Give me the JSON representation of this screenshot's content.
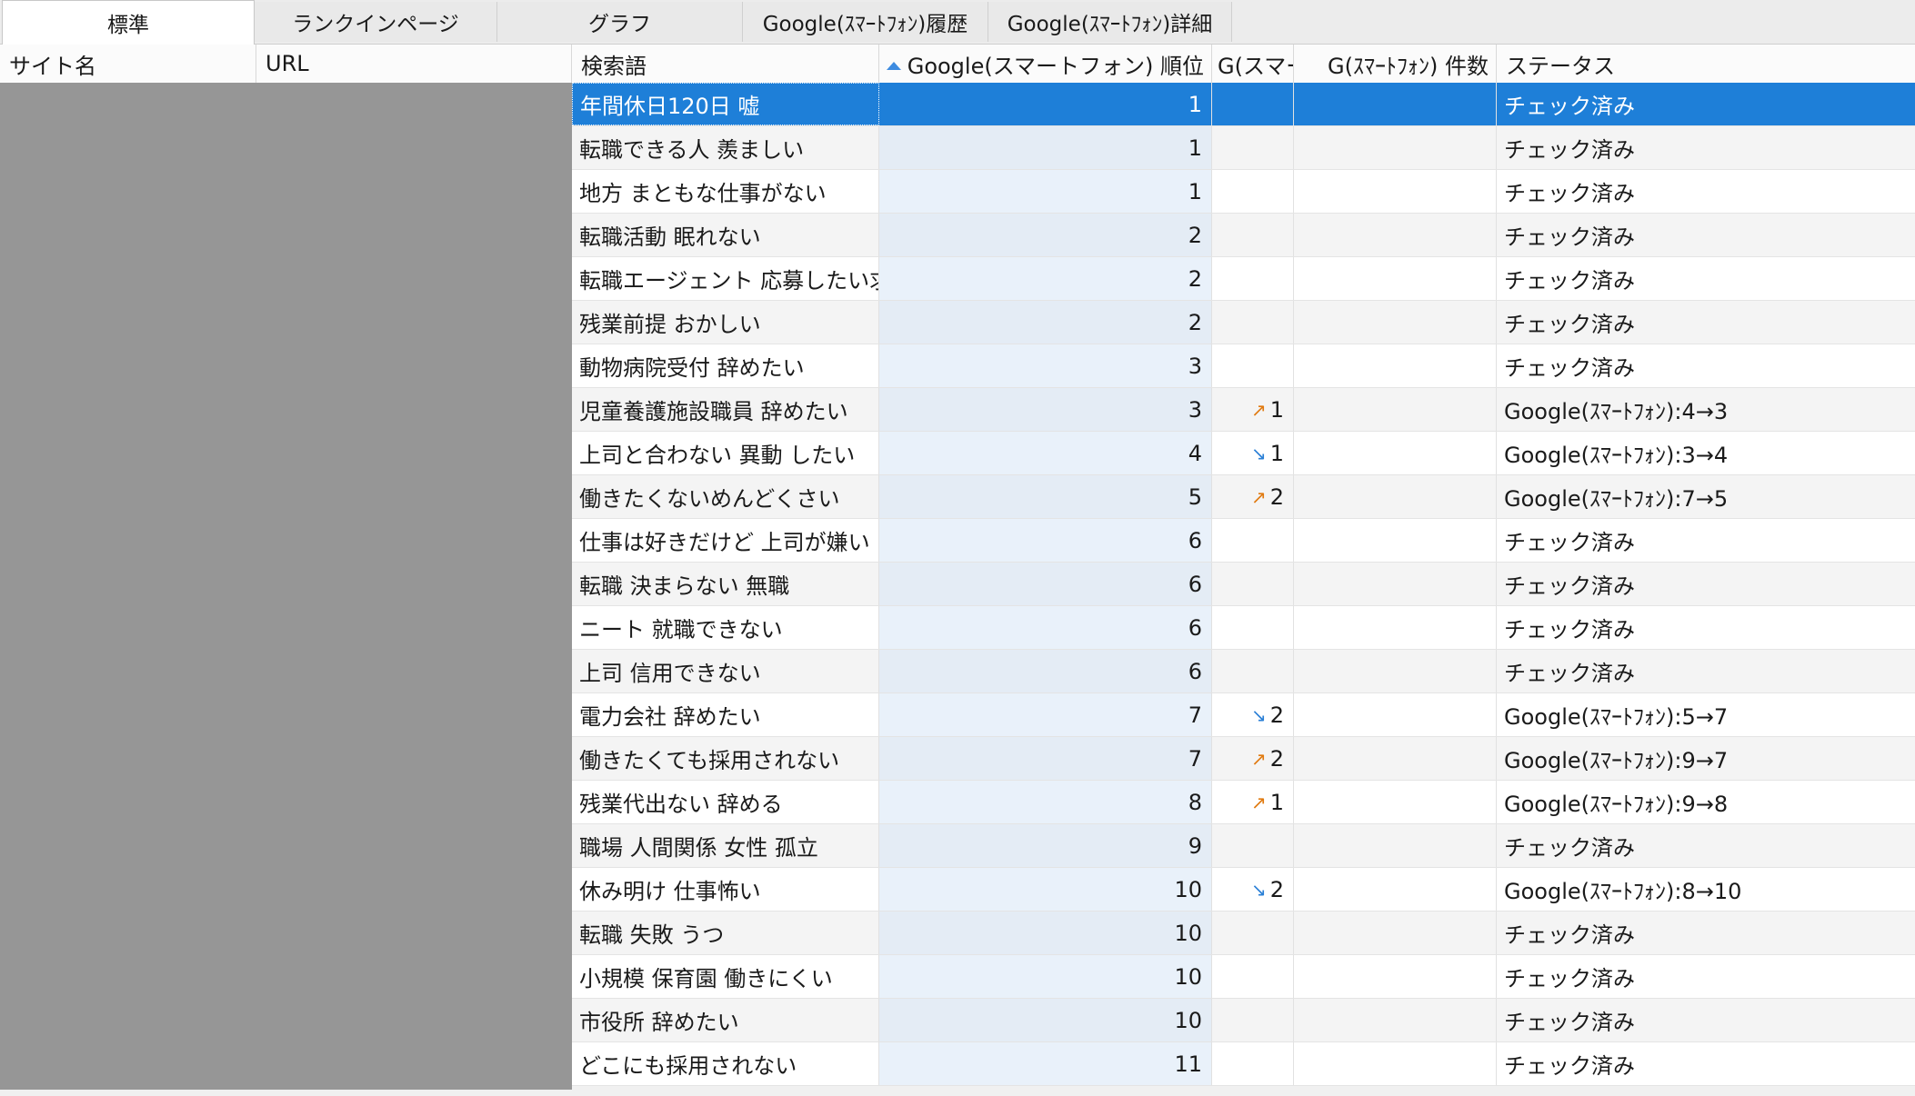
{
  "tabs": [
    {
      "label": "標準",
      "active": true
    },
    {
      "label": "ランクインページ",
      "active": false
    },
    {
      "label": "グラフ",
      "active": false
    },
    {
      "label": "Google(ｽﾏｰﾄﾌｫﾝ)履歴",
      "active": false
    },
    {
      "label": "Google(ｽﾏｰﾄﾌｫﾝ)詳細",
      "active": false
    }
  ],
  "columns": {
    "site": "サイト名",
    "url": "URL",
    "keyword": "検索語",
    "rank": "Google(スマートフォン) 順位",
    "change": "G(スマー..",
    "count": "G(ｽﾏｰﾄﾌｫﾝ) 件数",
    "status": "ステータス"
  },
  "colors": {
    "selected": "#1e7fd8",
    "up_arrow": "#e07a10",
    "down_arrow": "#2a7fd6",
    "redacted_block": "#969696"
  },
  "rows": [
    {
      "keyword": "年間休日120日 嘘",
      "rank": "1",
      "change_dir": "",
      "change": "",
      "status": "チェック済み",
      "selected": true
    },
    {
      "keyword": "転職できる人 羨ましい",
      "rank": "1",
      "change_dir": "",
      "change": "",
      "status": "チェック済み"
    },
    {
      "keyword": "地方 まともな仕事がない",
      "rank": "1",
      "change_dir": "",
      "change": "",
      "status": "チェック済み"
    },
    {
      "keyword": "転職活動 眠れない",
      "rank": "2",
      "change_dir": "",
      "change": "",
      "status": "チェック済み"
    },
    {
      "keyword": "転職エージェント 応募したい求人..",
      "rank": "2",
      "change_dir": "",
      "change": "",
      "status": "チェック済み"
    },
    {
      "keyword": "残業前提 おかしい",
      "rank": "2",
      "change_dir": "",
      "change": "",
      "status": "チェック済み"
    },
    {
      "keyword": "動物病院受付 辞めたい",
      "rank": "3",
      "change_dir": "",
      "change": "",
      "status": "チェック済み"
    },
    {
      "keyword": "児童養護施設職員 辞めたい",
      "rank": "3",
      "change_dir": "up",
      "change": "1",
      "status": "Google(ｽﾏｰﾄﾌｫﾝ):4→3"
    },
    {
      "keyword": "上司と合わない 異動 したい",
      "rank": "4",
      "change_dir": "down",
      "change": "1",
      "status": "Google(ｽﾏｰﾄﾌｫﾝ):3→4"
    },
    {
      "keyword": "働きたくないめんどくさい",
      "rank": "5",
      "change_dir": "up",
      "change": "2",
      "status": "Google(ｽﾏｰﾄﾌｫﾝ):7→5"
    },
    {
      "keyword": "仕事は好きだけど 上司が嫌い",
      "rank": "6",
      "change_dir": "",
      "change": "",
      "status": "チェック済み"
    },
    {
      "keyword": "転職 決まらない 無職",
      "rank": "6",
      "change_dir": "",
      "change": "",
      "status": "チェック済み"
    },
    {
      "keyword": "ニート 就職できない",
      "rank": "6",
      "change_dir": "",
      "change": "",
      "status": "チェック済み"
    },
    {
      "keyword": "上司 信用できない",
      "rank": "6",
      "change_dir": "",
      "change": "",
      "status": "チェック済み"
    },
    {
      "keyword": "電力会社 辞めたい",
      "rank": "7",
      "change_dir": "down",
      "change": "2",
      "status": "Google(ｽﾏｰﾄﾌｫﾝ):5→7"
    },
    {
      "keyword": "働きたくても採用されない",
      "rank": "7",
      "change_dir": "up",
      "change": "2",
      "status": "Google(ｽﾏｰﾄﾌｫﾝ):9→7"
    },
    {
      "keyword": "残業代出ない 辞める",
      "rank": "8",
      "change_dir": "up",
      "change": "1",
      "status": "Google(ｽﾏｰﾄﾌｫﾝ):9→8"
    },
    {
      "keyword": "職場 人間関係 女性 孤立",
      "rank": "9",
      "change_dir": "",
      "change": "",
      "status": "チェック済み"
    },
    {
      "keyword": "休み明け 仕事怖い",
      "rank": "10",
      "change_dir": "down",
      "change": "2",
      "status": "Google(ｽﾏｰﾄﾌｫﾝ):8→10"
    },
    {
      "keyword": "転職 失敗 うつ",
      "rank": "10",
      "change_dir": "",
      "change": "",
      "status": "チェック済み"
    },
    {
      "keyword": "小規模 保育園 働きにくい",
      "rank": "10",
      "change_dir": "",
      "change": "",
      "status": "チェック済み"
    },
    {
      "keyword": "市役所 辞めたい",
      "rank": "10",
      "change_dir": "",
      "change": "",
      "status": "チェック済み"
    },
    {
      "keyword": "どこにも採用されない",
      "rank": "11",
      "change_dir": "",
      "change": "",
      "status": "チェック済み"
    }
  ]
}
